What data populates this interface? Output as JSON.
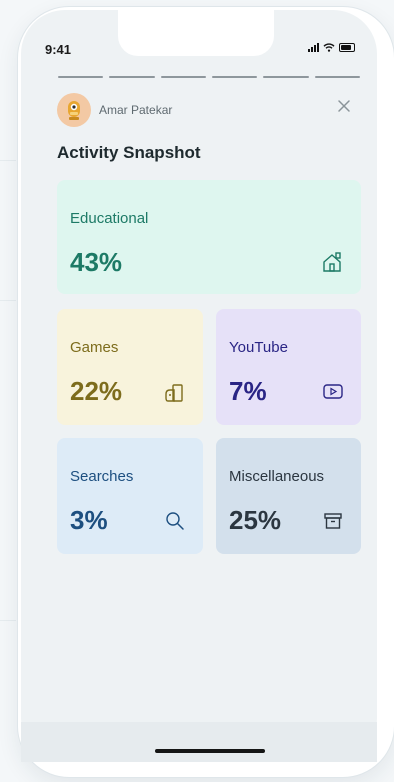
{
  "status_bar": {
    "time": "9:41"
  },
  "header": {
    "user_name": "Amar Patekar"
  },
  "page": {
    "title": "Activity Snapshot"
  },
  "cards": [
    {
      "label": "Educational",
      "value": "43%",
      "icon": "home-icon",
      "bg": "#def6ef",
      "fg": "#1d7a66"
    },
    {
      "label": "Games",
      "value": "22%",
      "icon": "game-icon",
      "bg": "#f8f3dc",
      "fg": "#7d6c1c"
    },
    {
      "label": "YouTube",
      "value": "7%",
      "icon": "play-icon",
      "bg": "#e6e1f8",
      "fg": "#2a2585"
    },
    {
      "label": "Searches",
      "value": "3%",
      "icon": "search-icon",
      "bg": "#ddebf7",
      "fg": "#1d4f80"
    },
    {
      "label": "Miscellaneous",
      "value": "25%",
      "icon": "archive-icon",
      "bg": "#d3e0ec",
      "fg": "#2b3640"
    }
  ]
}
